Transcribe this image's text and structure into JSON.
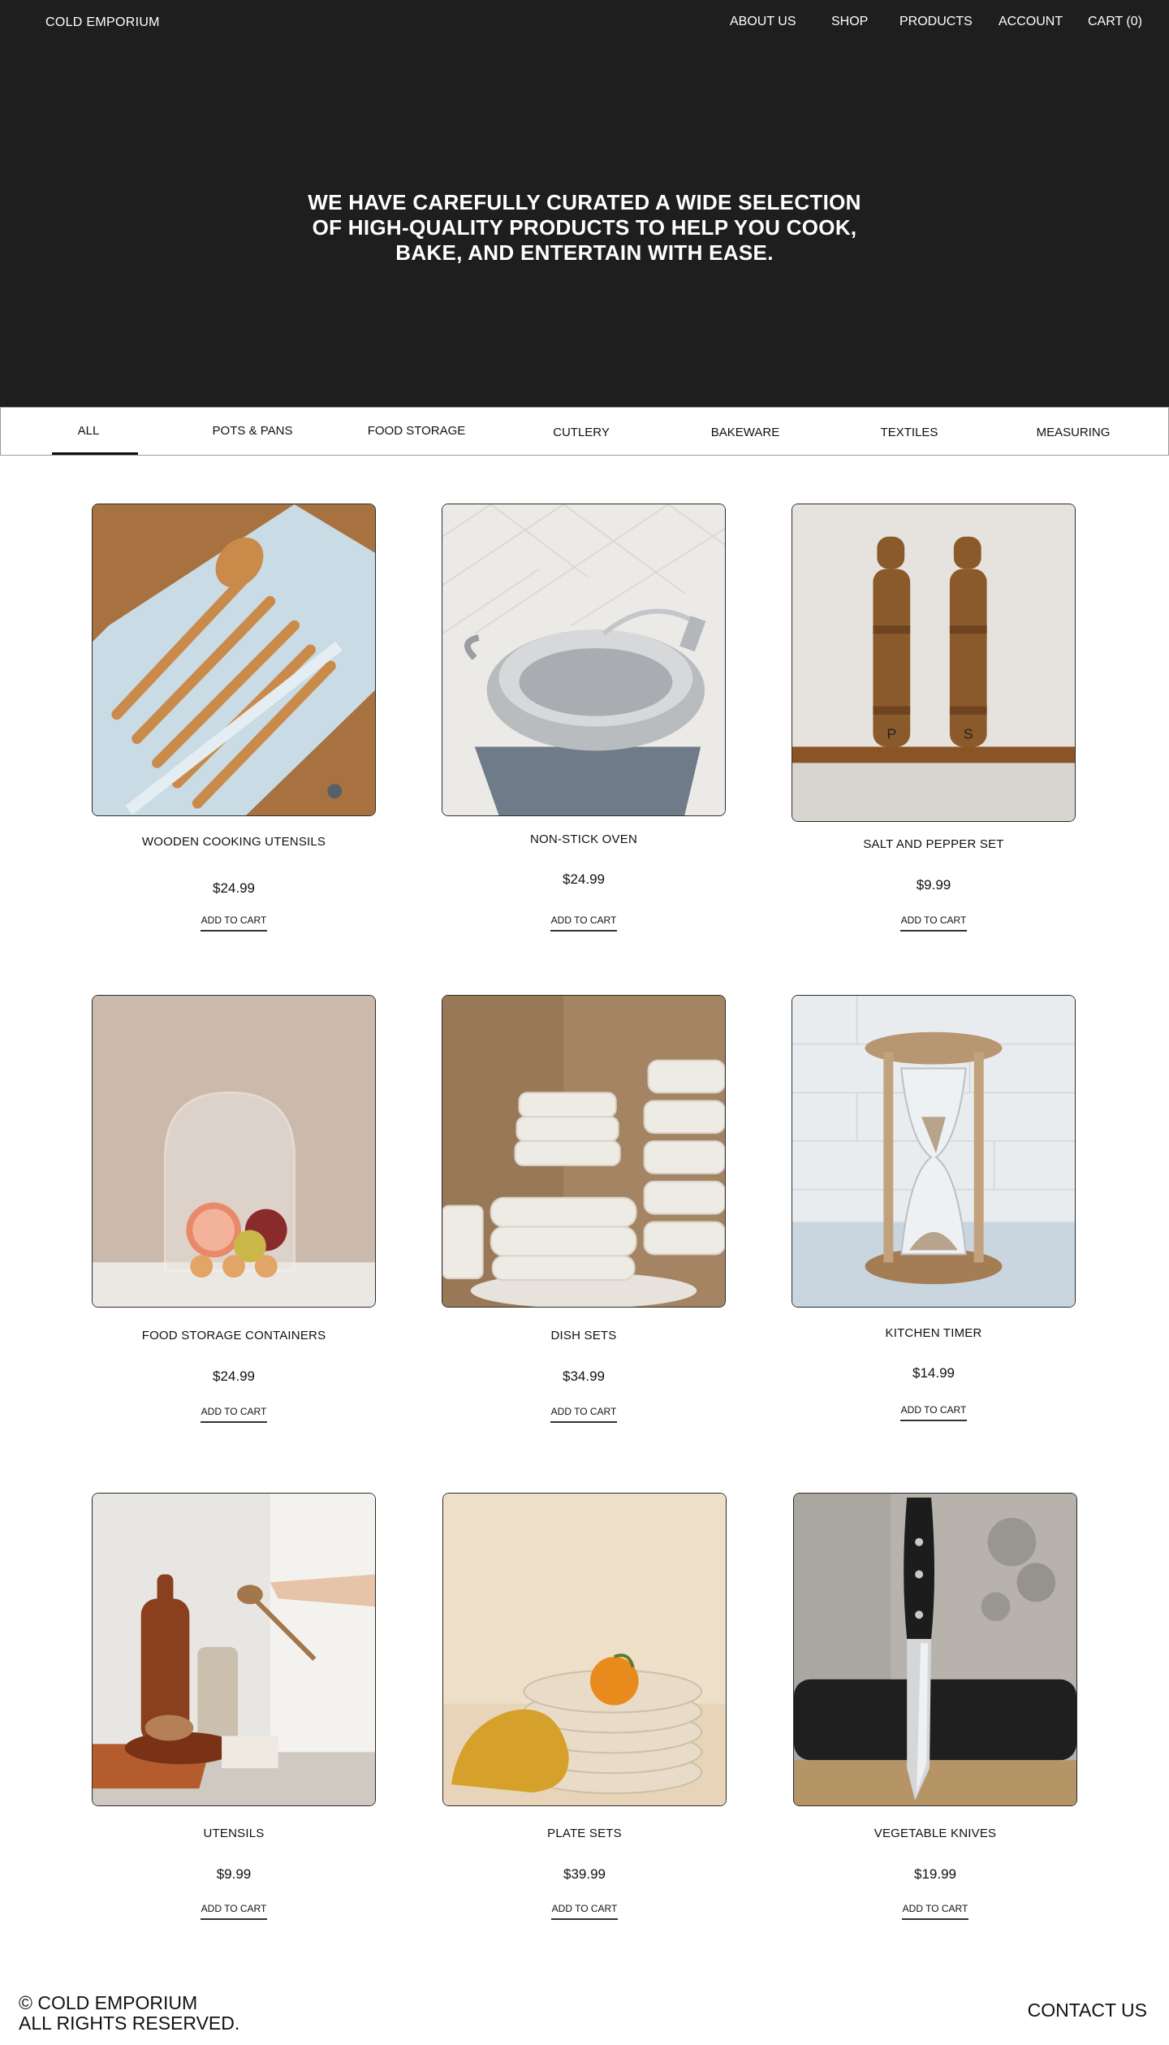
{
  "header": {
    "brand": "COLD EMPORIUM",
    "nav": [
      {
        "label": "ABOUT US"
      },
      {
        "label": "SHOP"
      },
      {
        "label": "PRODUCTS"
      },
      {
        "label": "ACCOUNT"
      },
      {
        "label": "CART (0)"
      }
    ]
  },
  "hero": {
    "title": "WE HAVE CAREFULLY CURATED A WIDE SELECTION OF HIGH-QUALITY PRODUCTS TO HELP YOU COOK, BAKE, AND ENTERTAIN WITH EASE."
  },
  "categories": {
    "active": "ALL",
    "tabs": [
      {
        "label": "ALL"
      },
      {
        "label": "POTS & PANS"
      },
      {
        "label": "FOOD STORAGE"
      },
      {
        "label": "CUTLERY"
      },
      {
        "label": "BAKEWARE"
      },
      {
        "label": "TEXTILES"
      },
      {
        "label": "MEASURING"
      }
    ]
  },
  "products": [
    {
      "name": "WOODEN COOKING UTENSILS",
      "price": "$24.99",
      "cta": "ADD TO CART",
      "image": "wooden-utensils-image"
    },
    {
      "name": "NON-STICK OVEN",
      "price": "$24.99",
      "cta": "ADD TO CART",
      "image": "steel-pan-image"
    },
    {
      "name": "SALT AND PEPPER SET",
      "price": "$9.99",
      "cta": "ADD TO CART",
      "image": "salt-pepper-mills-image"
    },
    {
      "name": "FOOD STORAGE CONTAINERS",
      "price": "$24.99",
      "cta": "ADD TO CART",
      "image": "glass-dome-fruit-image"
    },
    {
      "name": "DISH SETS",
      "price": "$34.99",
      "cta": "ADD TO CART",
      "image": "stacked-bowls-image"
    },
    {
      "name": "KITCHEN TIMER",
      "price": "$14.99",
      "cta": "ADD TO CART",
      "image": "hourglass-image"
    },
    {
      "name": "UTENSILS",
      "price": "$9.99",
      "cta": "ADD TO CART",
      "image": "wooden-kitchenware-image"
    },
    {
      "name": "PLATE SETS",
      "price": "$39.99",
      "cta": "ADD TO CART",
      "image": "plate-stack-orange-image"
    },
    {
      "name": "VEGETABLE KNIVES",
      "price": "$19.99",
      "cta": "ADD TO CART",
      "image": "knife-image"
    }
  ],
  "footer": {
    "copyright_line1": "© COLD EMPORIUM",
    "copyright_line2": "ALL RIGHTS RESERVED.",
    "contact": "CONTACT US"
  },
  "colors": {
    "hero_background": "#1e1e1e",
    "text": "#111111",
    "page_background": "#ffffff"
  }
}
